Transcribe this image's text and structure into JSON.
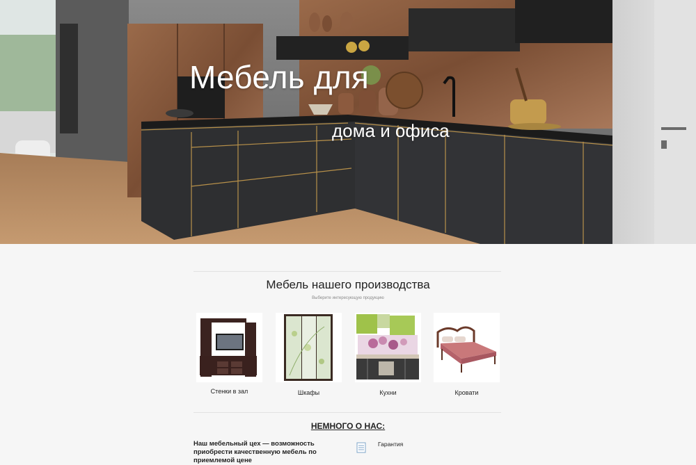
{
  "hero": {
    "title_line1": "Мебель для",
    "title_line2": "дома и офиса"
  },
  "products_section": {
    "title": "Мебель нашего производства",
    "subtitle": "Выберите интересующую продукцию",
    "items": [
      {
        "label": "Стенки в зал",
        "icon": "wall-unit-image"
      },
      {
        "label": "Шкафы",
        "icon": "wardrobe-image"
      },
      {
        "label": "Кухни",
        "icon": "kitchen-image"
      },
      {
        "label": "Кровати",
        "icon": "bed-image"
      }
    ]
  },
  "about": {
    "title": "НЕМНОГО О НАС:",
    "text": "Наш мебельный цех — возможность приобрести качественную мебель по приемлемой цене",
    "features": [
      {
        "label": "Гарантия",
        "icon": "document-icon"
      }
    ]
  },
  "colors": {
    "background": "#f6f6f6",
    "cabinet_dark": "#2e2f31",
    "copper_wall": "#8a5a3c",
    "gold_trim": "#b8914a"
  }
}
